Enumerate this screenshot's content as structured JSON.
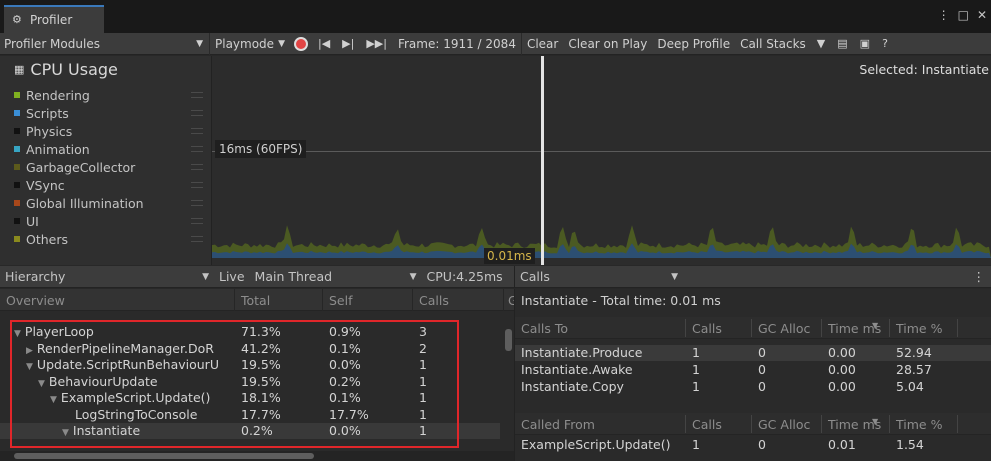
{
  "window": {
    "tab_title": "Profiler",
    "controls": [
      "⋮",
      "□",
      "✕"
    ]
  },
  "toolbar": {
    "modules_label": "Profiler Modules",
    "playmode_label": "Playmode",
    "frame_label": "Frame: 1911 / 2084",
    "clear_label": "Clear",
    "clear_on_play_label": "Clear on Play",
    "deep_profile_label": "Deep Profile",
    "call_stacks_label": "Call Stacks"
  },
  "chart": {
    "module_title": "CPU Usage",
    "fps_marker": "16ms (60FPS)",
    "cursor_value": "0.01ms",
    "selected_label": "Selected: Instantiate",
    "legend": [
      {
        "label": "Rendering",
        "color": "#7fb020"
      },
      {
        "label": "Scripts",
        "color": "#3a8ed6"
      },
      {
        "label": "Physics",
        "color": "#111111"
      },
      {
        "label": "Animation",
        "color": "#37a5c3"
      },
      {
        "label": "GarbageCollector",
        "color": "#5c5a1c"
      },
      {
        "label": "VSync",
        "color": "#111111"
      },
      {
        "label": "Global Illumination",
        "color": "#a8481b"
      },
      {
        "label": "UI",
        "color": "#111111"
      },
      {
        "label": "Others",
        "color": "#8a8a1e"
      }
    ]
  },
  "hierarchy_bar": {
    "view_label": "Hierarchy",
    "live_label": "Live",
    "thread_label": "Main Thread",
    "cpu_label": "CPU:4.25ms"
  },
  "tree": {
    "headers": {
      "overview": "Overview",
      "total": "Total",
      "self": "Self",
      "calls": "Calls",
      "gc": "G"
    },
    "rows": [
      {
        "name": "PlayerLoop",
        "total": "71.3%",
        "self": "0.9%",
        "calls": "3",
        "tri": "▼",
        "indent": 0
      },
      {
        "name": "RenderPipelineManager.DoR",
        "total": "41.2%",
        "self": "0.1%",
        "calls": "2",
        "tri": "▶",
        "indent": 1
      },
      {
        "name": "Update.ScriptRunBehaviourU",
        "total": "19.5%",
        "self": "0.0%",
        "calls": "1",
        "tri": "▼",
        "indent": 1
      },
      {
        "name": "BehaviourUpdate",
        "total": "19.5%",
        "self": "0.2%",
        "calls": "1",
        "tri": "▼",
        "indent": 2
      },
      {
        "name": "ExampleScript.Update()",
        "total": "18.1%",
        "self": "0.1%",
        "calls": "1",
        "tri": "▼",
        "indent": 3
      },
      {
        "name": "LogStringToConsole",
        "total": "17.7%",
        "self": "17.7%",
        "calls": "1",
        "tri": "",
        "indent": 4
      },
      {
        "name": "Instantiate",
        "total": "0.2%",
        "self": "0.0%",
        "calls": "1",
        "tri": "▼",
        "indent": 4
      }
    ]
  },
  "calls_panel": {
    "dropdown_label": "Calls",
    "total_time": "Instantiate - Total time: 0.01 ms",
    "calls_to_headers": {
      "name": "Calls To",
      "calls": "Calls",
      "gc": "GC Alloc",
      "time_ms": "Time ms",
      "time_pct": "Time %"
    },
    "calls_to": [
      {
        "name": "Instantiate.Produce",
        "calls": "1",
        "gc": "0",
        "time_ms": "0.00",
        "time_pct": "52.94"
      },
      {
        "name": "Instantiate.Awake",
        "calls": "1",
        "gc": "0",
        "time_ms": "0.00",
        "time_pct": "28.57"
      },
      {
        "name": "Instantiate.Copy",
        "calls": "1",
        "gc": "0",
        "time_ms": "0.00",
        "time_pct": "5.04"
      }
    ],
    "called_from_headers": {
      "name": "Called From",
      "calls": "Calls",
      "gc": "GC Alloc",
      "time_ms": "Time ms",
      "time_pct": "Time %"
    },
    "called_from": [
      {
        "name": "ExampleScript.Update()",
        "calls": "1",
        "gc": "0",
        "time_ms": "0.01",
        "time_pct": "1.54"
      }
    ]
  }
}
